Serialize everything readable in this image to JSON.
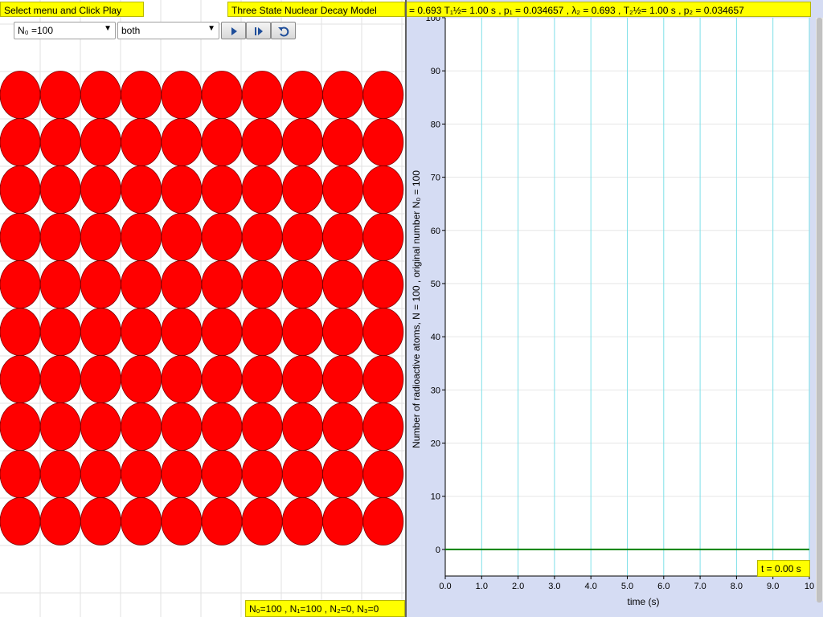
{
  "header": {
    "instruction": "Select menu and Click Play",
    "title": "Three State Nuclear Decay Model",
    "parameters": "= 0.693  T₁½= 1.00 s , p₁ = 0.034657 , λ₂ = 0.693 , T₂½= 1.00 s , p₂ = 0.034657"
  },
  "controls": {
    "n0_select": "N₀ =100",
    "mode_select": "both",
    "play_icon": "play-icon",
    "step_icon": "step-forward-icon",
    "reset_icon": "reset-icon"
  },
  "atoms": {
    "rows": 10,
    "cols": 10,
    "color": "#ff0000",
    "count": 100
  },
  "status": {
    "counts": "N₀=100 , N₁=100 , N₂=0, N₃=0"
  },
  "time_readout": "t = 0.00 s",
  "chart_data": {
    "type": "line",
    "xlabel": "time (s)",
    "ylabel": "Number of radioactive atoms, N = 100 , original number N₀ = 100",
    "xlim": [
      0,
      10
    ],
    "ylim": [
      -5,
      100
    ],
    "x_ticks": [
      "0.0",
      "1.0",
      "2.0",
      "3.0",
      "4.0",
      "5.0",
      "6.0",
      "7.0",
      "8.0",
      "9.0",
      "10"
    ],
    "y_ticks": [
      "0",
      "10",
      "20",
      "30",
      "40",
      "50",
      "60",
      "70",
      "80",
      "90",
      "100"
    ],
    "series": [
      {
        "x": [
          0,
          10
        ],
        "y": [
          0,
          0
        ],
        "color": "#008000"
      }
    ],
    "grid_color": "#7fe0e8",
    "plot_bg": "#ffffff",
    "panel_bg": "#d5dcf3"
  }
}
